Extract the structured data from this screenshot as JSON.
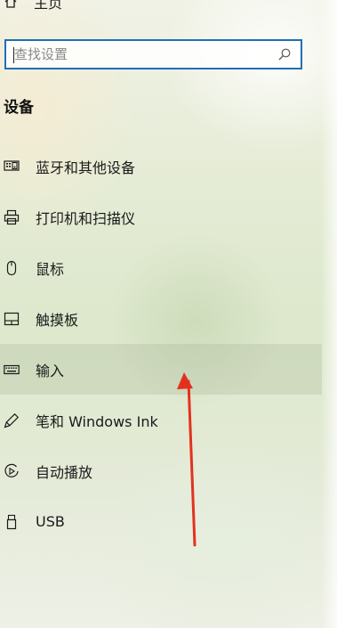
{
  "header": {
    "home_label": "主页"
  },
  "search": {
    "placeholder": "查找设置"
  },
  "section": {
    "title": "设备"
  },
  "nav": {
    "items": [
      {
        "label": "蓝牙和其他设备",
        "icon": "bluetooth-devices-icon"
      },
      {
        "label": "打印机和扫描仪",
        "icon": "printer-icon"
      },
      {
        "label": "鼠标",
        "icon": "mouse-icon"
      },
      {
        "label": "触摸板",
        "icon": "touchpad-icon"
      },
      {
        "label": "输入",
        "icon": "keyboard-icon",
        "selected": true
      },
      {
        "label": "笔和 Windows Ink",
        "icon": "pen-icon"
      },
      {
        "label": "自动播放",
        "icon": "autoplay-icon"
      },
      {
        "label": "USB",
        "icon": "usb-icon"
      }
    ]
  },
  "colors": {
    "search_border": "#1e6fb8",
    "arrow": "#e2321f",
    "selected_bg": "#a8b692"
  }
}
